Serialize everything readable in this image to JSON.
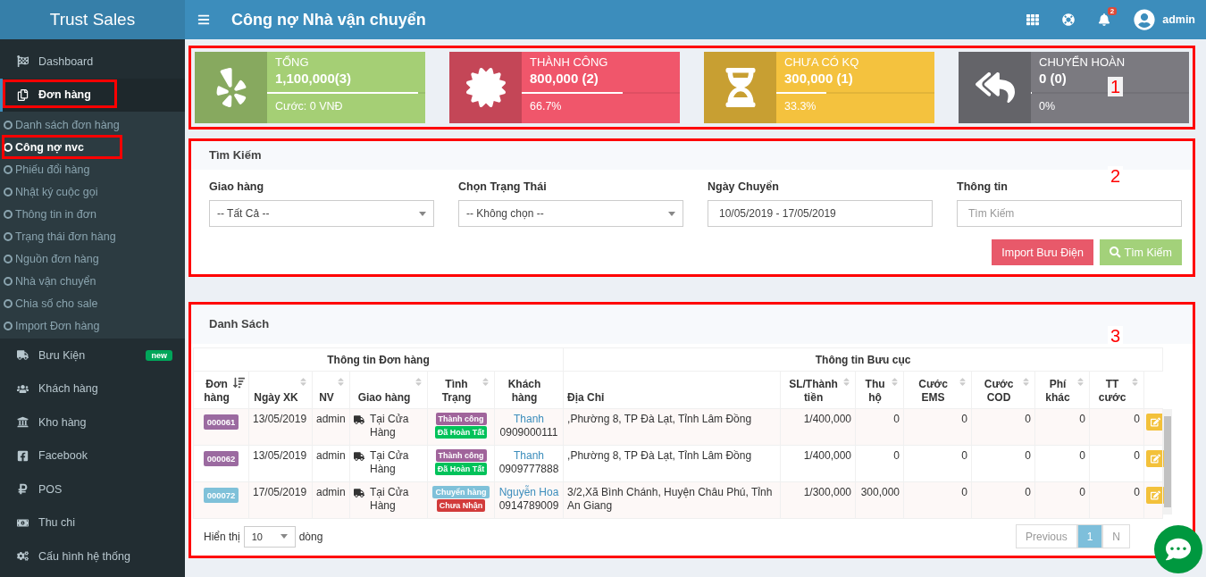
{
  "brand": "Trust Sales",
  "page_title": "Công nợ Nhà vận chuyển",
  "header": {
    "notification_count": "2",
    "user": "admin"
  },
  "sidebar": {
    "items": [
      {
        "label": "Dashboard",
        "selected": false,
        "annotated": false
      },
      {
        "label": "Đơn hàng",
        "selected": true,
        "annotated": true,
        "expanded": true,
        "children": [
          {
            "label": "Danh sách đơn hàng",
            "selected": false,
            "annotated": false
          },
          {
            "label": "Công nợ nvc",
            "selected": true,
            "annotated": true
          },
          {
            "label": "Phiếu đổi hàng",
            "selected": false,
            "annotated": false
          },
          {
            "label": "Nhật ký cuộc gọi",
            "selected": false,
            "annotated": false
          },
          {
            "label": "Thông tin in đơn",
            "selected": false,
            "annotated": false
          },
          {
            "label": "Trạng thái đơn hàng",
            "selected": false,
            "annotated": false
          },
          {
            "label": "Nguồn đơn hàng",
            "selected": false,
            "annotated": false
          },
          {
            "label": "Nhà vận chuyển",
            "selected": false,
            "annotated": false
          },
          {
            "label": "Chia số cho sale",
            "selected": false,
            "annotated": false
          },
          {
            "label": "Import Đơn hàng",
            "selected": false,
            "annotated": false
          }
        ]
      },
      {
        "label": "Bưu Kiện",
        "selected": false,
        "annotated": false,
        "badge": "new"
      },
      {
        "label": "Khách hàng",
        "selected": false,
        "annotated": false
      },
      {
        "label": "Kho hàng",
        "selected": false,
        "annotated": false
      },
      {
        "label": "Facebook",
        "selected": false,
        "annotated": false
      },
      {
        "label": "POS",
        "selected": false,
        "annotated": false
      },
      {
        "label": "Thu chi",
        "selected": false,
        "annotated": false
      },
      {
        "label": "Cấu hình hệ thống",
        "selected": false,
        "annotated": false
      }
    ]
  },
  "stats": {
    "annotation": "1",
    "cards": [
      {
        "color": "#a5cf75",
        "title": "TỔNG",
        "value": "1,100,000(3)",
        "level": 1,
        "footer": "Cước: 0 VNĐ"
      },
      {
        "color": "#f0566b",
        "title": "THÀNH CÔNG",
        "value": "800,000 (2)",
        "level": 0.667,
        "footer": "66.7%"
      },
      {
        "color": "#f4c23e",
        "title": "CHƯA CÓ KQ",
        "value": "300,000 (1)",
        "level": 0.333,
        "footer": "33.3%"
      },
      {
        "color": "#7b7a80",
        "title": "CHUYỂN HOÀN",
        "value": "0 (0)",
        "level": 0,
        "footer": "0%"
      }
    ]
  },
  "search": {
    "annotation": "2",
    "title": "Tìm Kiếm",
    "fields": [
      {
        "kind": "select",
        "label": "Giao hàng",
        "value": "-- Tất Cả --"
      },
      {
        "kind": "select",
        "label": "Chọn Trạng Thái",
        "value": "-- Không chọn --"
      },
      {
        "kind": "input",
        "label": "Ngày Chuyển",
        "value": "10/05/2019 - 17/05/2019"
      },
      {
        "kind": "input",
        "label": "Thông tin",
        "placeholder": "Tìm Kiếm"
      }
    ],
    "buttons": [
      {
        "kind": "danger",
        "label": "Import Bưu Điện"
      },
      {
        "kind": "search",
        "label": "Tìm Kiếm"
      }
    ]
  },
  "list": {
    "annotation": "3",
    "title": "Danh Sách",
    "table": {
      "groups": [
        {
          "label": "Thông tin Đơn hàng",
          "columns": [
            {
              "label": "Đơn hàng",
              "sortable": true,
              "sorted": true
            },
            {
              "label": "Ngày XK",
              "sortable": true,
              "sorted": false
            },
            {
              "label": "NV",
              "sortable": true,
              "sorted": false
            },
            {
              "label": "Giao hàng",
              "sortable": true,
              "sorted": false
            },
            {
              "label": "Tình Trạng",
              "sortable": true,
              "sorted": false
            },
            {
              "label": "Khách hàng"
            }
          ]
        },
        {
          "label": "Thông tin Bưu cục",
          "columns": [
            {
              "label": "Địa Chỉ"
            },
            {
              "label": "SL/Thành tiền",
              "sortable": true,
              "sorted": false
            },
            {
              "label": "Thu hộ",
              "sortable": true,
              "sorted": false
            },
            {
              "label": "Cước EMS",
              "sortable": true,
              "sorted": false
            },
            {
              "label": "Cước COD",
              "sortable": true,
              "sorted": false
            },
            {
              "label": "Phí khác",
              "sortable": true,
              "sorted": false
            },
            {
              "label": "TT cước",
              "sortable": true,
              "sorted": false
            }
          ]
        }
      ],
      "rows": [
        {
          "order": {
            "code": "000061",
            "color": "#9b6aa0"
          },
          "date": "13/05/2019",
          "staff": "admin",
          "shipping": "Tại Cửa Hàng",
          "statuses": [
            {
              "label": "Thành công",
              "color": "#a0649b"
            },
            {
              "label": "Đã Hoàn Tất",
              "color": "#00c25a"
            }
          ],
          "customer": {
            "name": "Thanh",
            "phone": "0909000111"
          },
          "address": ",Phường 8, TP Đà Lạt, Tỉnh Lâm Đồng",
          "amounts": [
            "1/400,000",
            "0",
            "0",
            "0",
            "0",
            "0"
          ]
        },
        {
          "order": {
            "code": "000062",
            "color": "#9b6aa0"
          },
          "date": "13/05/2019",
          "staff": "admin",
          "shipping": "Tại Cửa Hàng",
          "statuses": [
            {
              "label": "Thành công",
              "color": "#a0649b"
            },
            {
              "label": "Đã Hoàn Tất",
              "color": "#00c25a"
            }
          ],
          "customer": {
            "name": "Thanh",
            "phone": "0909777888"
          },
          "address": ",Phường 8, TP Đà Lạt, Tỉnh Lâm Đồng",
          "amounts": [
            "1/400,000",
            "0",
            "0",
            "0",
            "0",
            "0"
          ]
        },
        {
          "order": {
            "code": "000072",
            "color": "#7fc1d9"
          },
          "date": "17/05/2019",
          "staff": "admin",
          "shipping": "Tại Cửa Hàng",
          "statuses": [
            {
              "label": "Chuyển hàng",
              "color": "#7fc1d9"
            },
            {
              "label": "Chưa Nhận",
              "color": "#d23b3b"
            }
          ],
          "customer": {
            "name": "Nguyễn Hoa",
            "phone": "0914789009"
          },
          "address": "3/2,Xã Bình Chánh, Huyện Châu Phú, Tỉnh An Giang",
          "amounts": [
            "1/300,000",
            "300,000",
            "0",
            "0",
            "0",
            "0"
          ]
        }
      ]
    },
    "page_size": {
      "before": "Hiển thị",
      "value": "10",
      "after": "dòng"
    },
    "pagination": [
      {
        "label": "Previous",
        "selected": false
      },
      {
        "label": "1",
        "selected": true
      },
      {
        "label": "N",
        "selected": false
      }
    ]
  }
}
